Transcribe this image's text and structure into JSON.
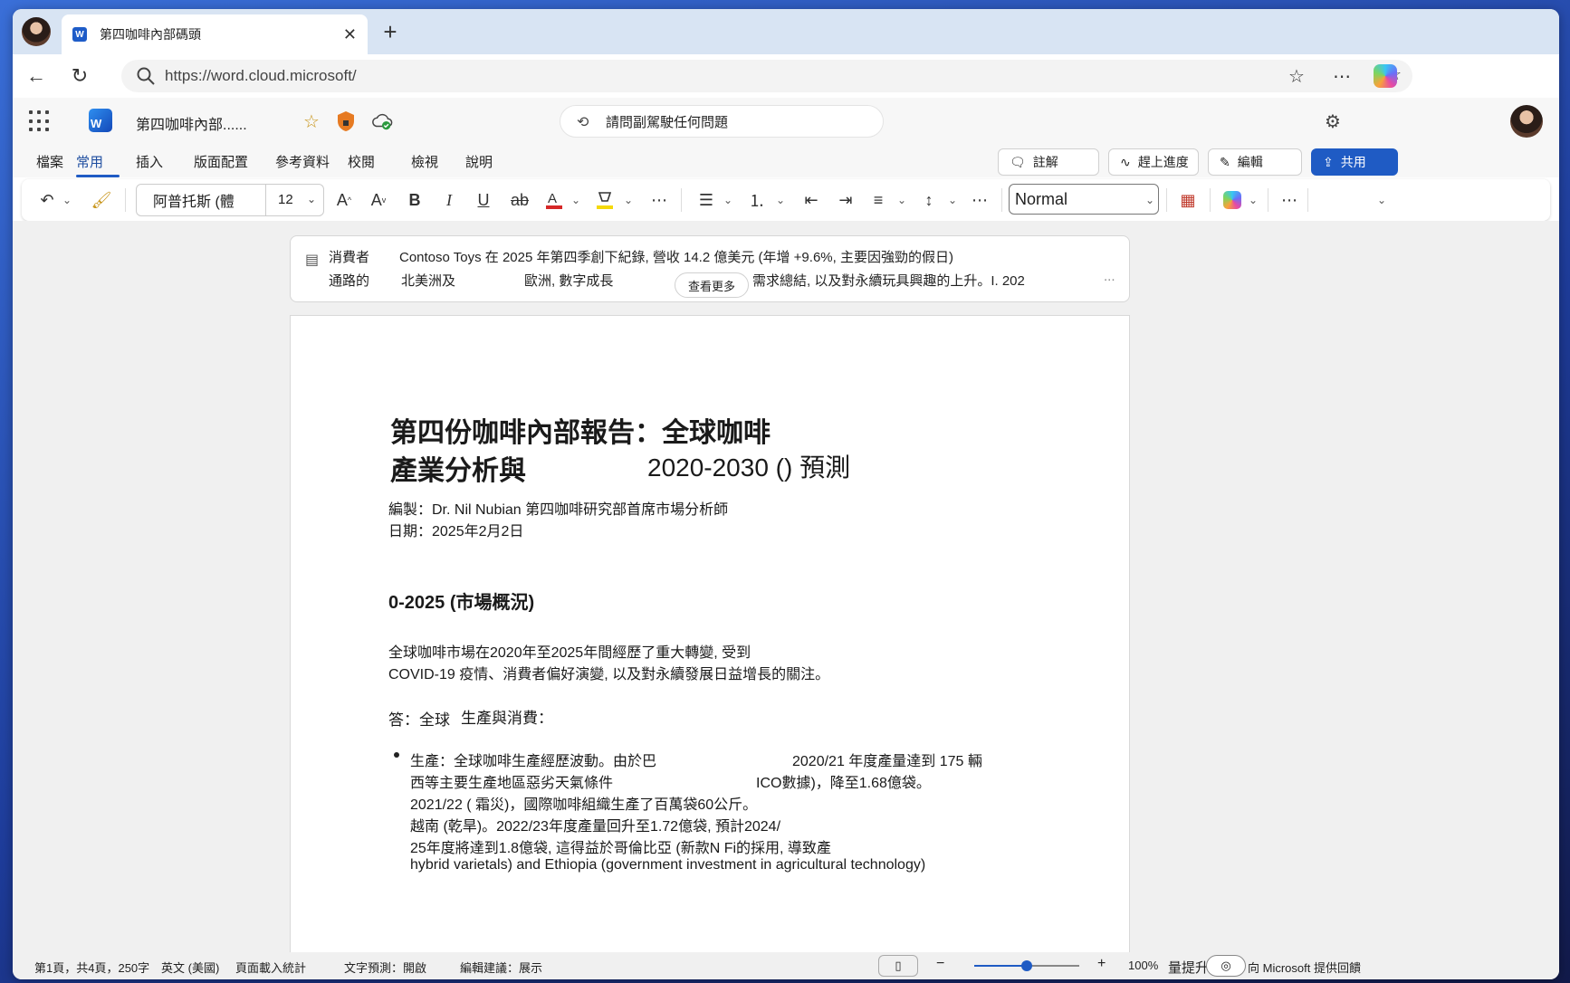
{
  "browser": {
    "tab_title": "第四咖啡內部碼頭",
    "url": "https://word.cloud.microsoft/"
  },
  "app": {
    "doc_name": "第四咖啡內部......",
    "ask_copilot": "請問副駕駛任何問題",
    "menu_tabs": [
      "檔案",
      "常用",
      "插入",
      "版面配置",
      "參考資料",
      "校閱",
      "檢視",
      "說明"
    ],
    "active_tab": "常用",
    "actions": {
      "comments": "註解",
      "catch_up": "趕上進度",
      "editing": "編輯",
      "share": "共用"
    }
  },
  "ribbon": {
    "font_name": "阿普托斯 (體",
    "font_size": "12",
    "style": "Normal"
  },
  "summary": {
    "label_line1": "消費者",
    "label_line2": "通路的",
    "line1": "Contoso Toys 在 2025 年第四季創下紀錄, 營收 14.2 億美元 (年增 +9.6%, 主要因強勁的假日)",
    "line2_a": "北美洲及",
    "line2_b": "歐洲, 數字成長",
    "line2_c": "需求總結, 以及對永續玩具興趣的上升。I. 202",
    "see_more": "查看更多",
    "ellipsis": "..."
  },
  "document": {
    "title_line1": "第四份咖啡內部報告：全球咖啡",
    "title_line2a": "產業分析與",
    "title_line2b": "2020-2030 () 預測",
    "author": "編製：Dr. Nil Nubian 第四咖啡研究部首席市場分析師",
    "date": "日期：2025年2月2日",
    "section_heading": "0-2025 (市場概況)",
    "intro_line1": "全球咖啡市場在2020年至2025年間經歷了重大轉變, 受到",
    "intro_line2": "COVID-19 疫情、消費者偏好演變, 以及對永續發展日益增長的關注。",
    "sub_a": "答：全球",
    "sub_b": "生產與消費：",
    "bullet_lines": [
      [
        "生產：全球咖啡生產經歷波動。由於巴",
        "2020/21 年度產量達到 175 輛"
      ],
      [
        "西等主要生產地區惡劣天氣條件",
        "ICO數據)，降至1.68億袋。"
      ],
      [
        "2021/22 ( 霜災)，國際咖啡組織生產了百萬袋60公斤。",
        ""
      ],
      [
        "越南 (乾旱)。2022/23年度產量回升至1.72億袋, 預計2024/",
        ""
      ],
      [
        "25年度將達到1.8億袋, 這得益於哥倫比亞 (新款N Fi的採用, 導致產",
        ""
      ],
      [
        "hybrid varietals) and Ethiopia (government investment in agricultural technology)",
        ""
      ]
    ]
  },
  "statusbar": {
    "page": "第1頁，共4頁，250字",
    "language": "英文 (美國)",
    "stats": "頁面載入統計",
    "prediction": "文字預測：開啟",
    "suggestions": "編輯建議：展示",
    "zoom": "100%",
    "zoom_level": 0.5,
    "boost": "量提升",
    "feedback": "向 Microsoft 提供回饋"
  },
  "colors": {
    "accent": "#1f5bc4",
    "tabstrip": "#d8e4f3"
  }
}
